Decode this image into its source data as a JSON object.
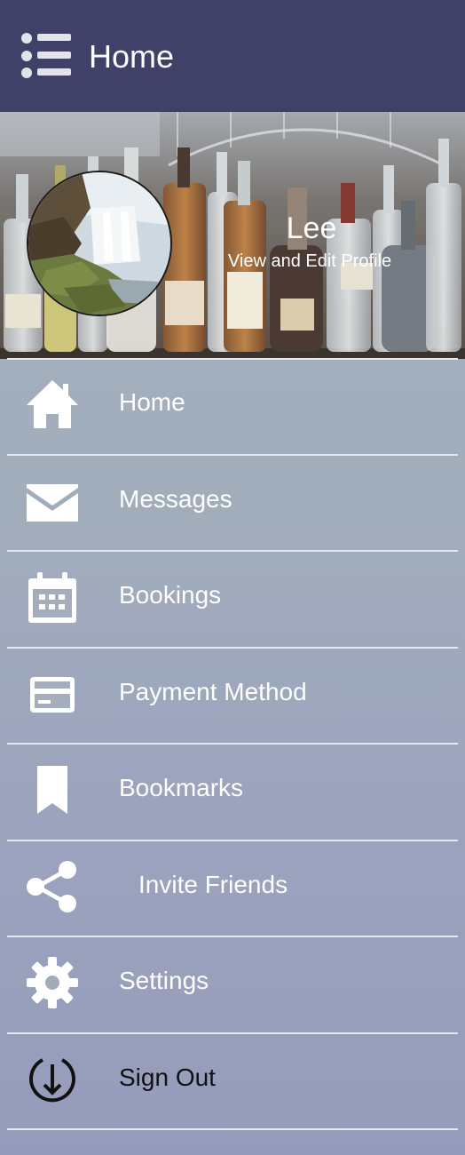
{
  "header": {
    "title": "Home",
    "menu_icon": "list-menu-icon",
    "background": "#3f4168"
  },
  "profile": {
    "name": "Lee",
    "link": "View and Edit Profile",
    "background_image": "bar-shelf-bottles",
    "avatar_image": "waterfall-landscape"
  },
  "menu": {
    "items": [
      {
        "label": "Home",
        "icon": "home-icon"
      },
      {
        "label": "Messages",
        "icon": "envelope-icon"
      },
      {
        "label": "Bookings",
        "icon": "calendar-icon"
      },
      {
        "label": "Payment Method",
        "icon": "credit-card-icon"
      },
      {
        "label": "Bookmarks",
        "icon": "bookmark-icon"
      },
      {
        "label": "Invite Friends",
        "icon": "share-icon"
      },
      {
        "label": "Settings",
        "icon": "gear-icon"
      },
      {
        "label": "Sign Out",
        "icon": "sign-out-icon"
      }
    ],
    "divider_color": "#e4e9ee",
    "label_color": "#ffffff",
    "sign_out_color": "#111111"
  }
}
